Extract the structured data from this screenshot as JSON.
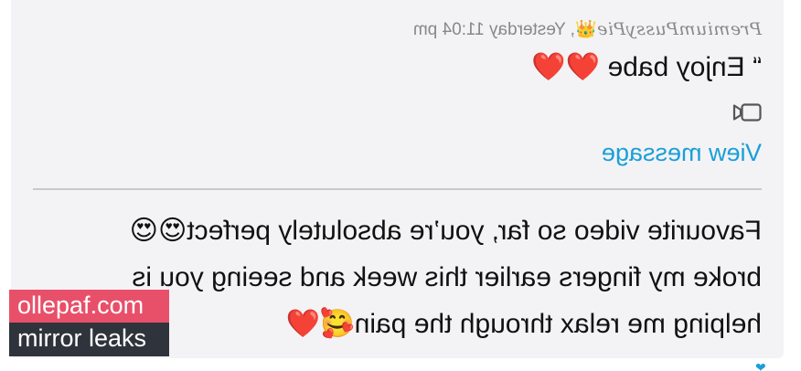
{
  "message": {
    "sender": "PremiumPussyPie",
    "sender_badge": "👑",
    "separator": ", ",
    "timestamp": "Yesterday 11:04 pm",
    "quote": "“ Enjoy babe ❤️❤️",
    "attachment_icon": "video-camera-icon",
    "view_link": "View message",
    "reply_lines": [
      "Favourite video so far, you’re absolutely perfect😍😍",
      "broke my fingers earlier this week and seeing you is",
      "helping me relax through the pain🥰❤️"
    ]
  },
  "watermark": {
    "line1": "ollepaf.com",
    "line2": "mirror leaks"
  },
  "colors": {
    "card_bg": "#f3f3f5",
    "link": "#1a9fd8",
    "meta_text": "#888888",
    "watermark_pink": "#e8506a",
    "watermark_dark": "#2f343c"
  }
}
